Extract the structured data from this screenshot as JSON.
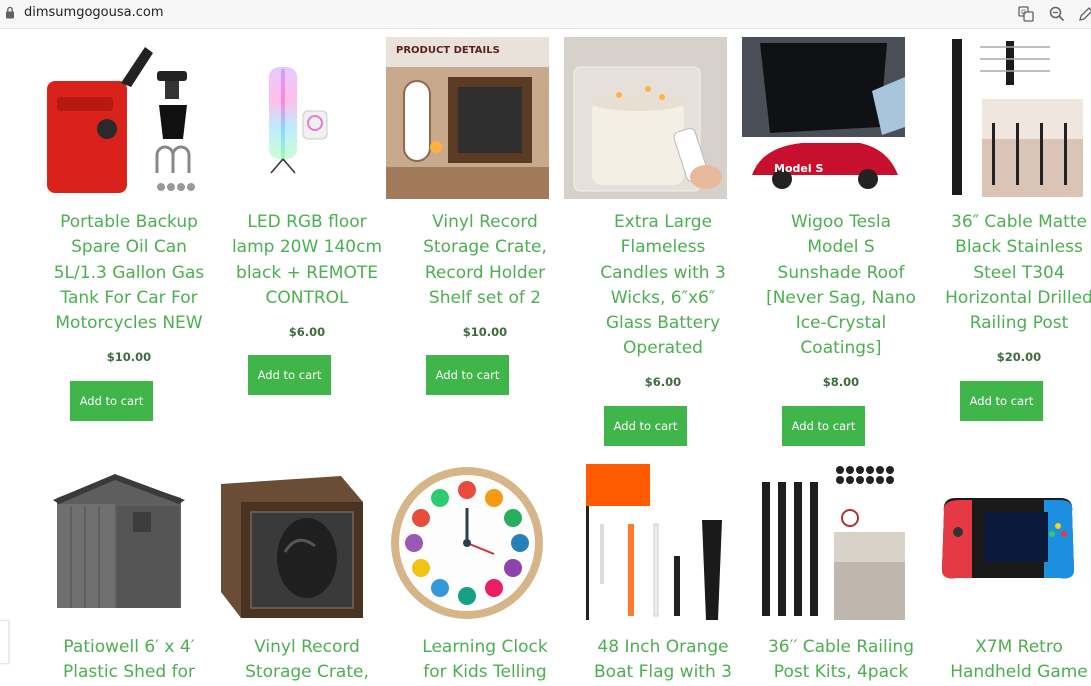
{
  "browser": {
    "url": "dimsumgogousa.com",
    "icons": [
      "lock-icon",
      "translate-icon",
      "zoom-icon",
      "edit-icon"
    ]
  },
  "colors": {
    "accent": "#4caf50",
    "button": "#3fb54a",
    "button_text": "#ffffff"
  },
  "products": [
    {
      "title": "Portable Backup Spare Oil Can 5L/1.3 Gallon Gas Tank For Car For Motorcycles NEW",
      "lines": [
        "Portable Backup",
        "Spare Oil Can",
        "5L/1.3 Gallon Gas",
        "Tank For Car For",
        "Motorcycles NEW"
      ],
      "price": "$10.00",
      "button": "Add to cart"
    },
    {
      "title": "LED RGB floor lamp 20W 140cm black + REMOTE CONTROL",
      "lines": [
        "LED RGB floor",
        "lamp 20W 140cm",
        "black + REMOTE",
        "CONTROL"
      ],
      "price": "$6.00",
      "button": "Add to cart"
    },
    {
      "title": "Vinyl Record Storage Crate, Record Holder Shelf set of 2",
      "lines": [
        "Vinyl Record",
        "Storage Crate,",
        "Record Holder",
        "Shelf set of 2"
      ],
      "price": "$10.00",
      "button": "Add to cart",
      "image_text": "PRODUCT DETAILS"
    },
    {
      "title": "Extra Large Flameless Candles with 3 Wicks, 6\"x6\" Glass Battery Operated",
      "lines": [
        "Extra Large",
        "Flameless",
        "Candles with 3",
        "Wicks, 6″x6″",
        "Glass Battery",
        "Operated"
      ],
      "price": "$6.00",
      "button": "Add to cart"
    },
    {
      "title": "Wigoo Tesla Model S Sunshade Roof [Never Sag, Nano Ice-Crystal Coatings]",
      "lines": [
        "Wigoo Tesla",
        "Model S",
        "Sunshade Roof",
        "[Never Sag, Nano",
        "Ice-Crystal",
        "Coatings]"
      ],
      "price": "$8.00",
      "button": "Add to cart",
      "image_text": "Model S"
    },
    {
      "title": "36\" Cable Matte Black Stainless Steel T304 Horizontal Drilled Railing Post",
      "lines": [
        "36″ Cable Matte",
        "Black Stainless",
        "Steel T304",
        "Horizontal Drilled",
        "Railing Post"
      ],
      "price": "$20.00",
      "button": "Add to cart"
    },
    {
      "title": "Patiowell 6' x 4' Plastic Shed for",
      "lines": [
        "Patiowell 6′ x 4′",
        "Plastic Shed for"
      ]
    },
    {
      "title": "Vinyl Record Storage Crate,",
      "lines": [
        "Vinyl Record",
        "Storage Crate,"
      ]
    },
    {
      "title": "Learning Clock for Kids Telling",
      "lines": [
        "Learning Clock",
        "for Kids Telling"
      ]
    },
    {
      "title": "48 Inch Orange Boat Flag with 3",
      "lines": [
        "48 Inch Orange",
        "Boat Flag with 3"
      ]
    },
    {
      "title": "36'' Cable Railing Post Kits, 4pack",
      "lines": [
        "36′′ Cable Railing",
        "Post Kits, 4pack"
      ]
    },
    {
      "title": "X7M Retro Handheld Game",
      "lines": [
        "X7M Retro",
        "Handheld Game"
      ]
    }
  ]
}
